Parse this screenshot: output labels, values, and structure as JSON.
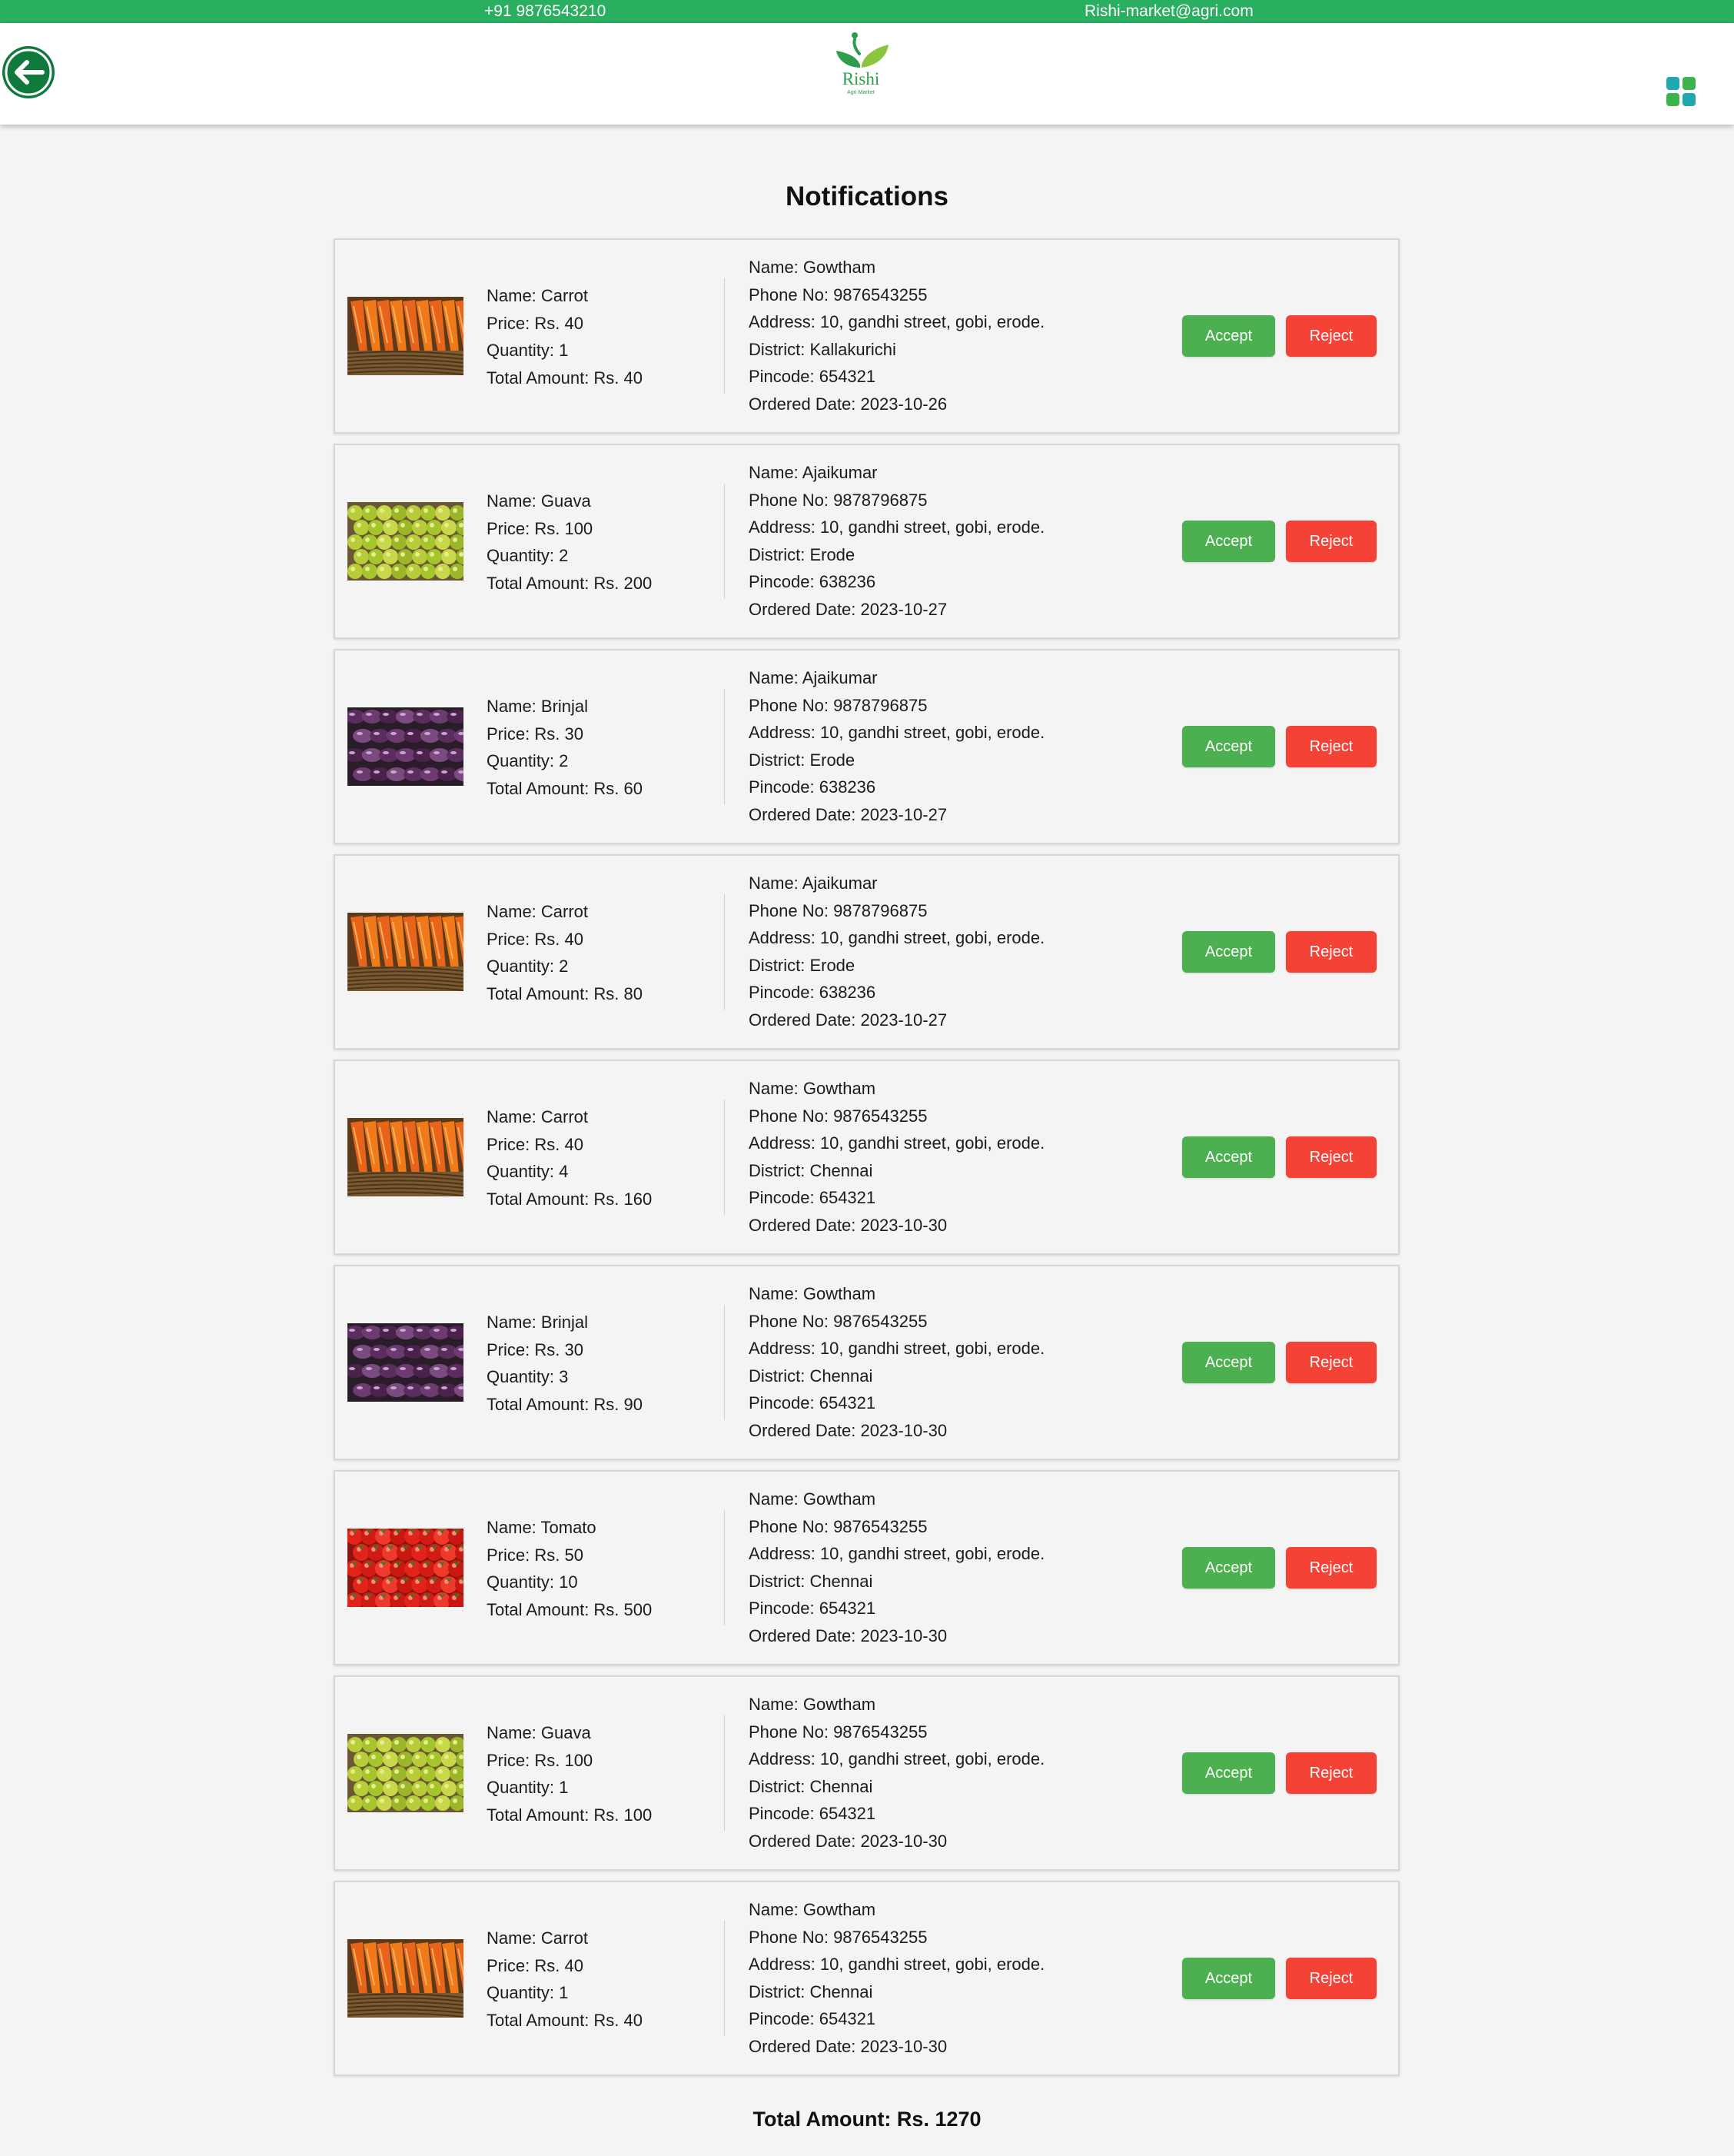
{
  "topbar": {
    "phone": "+91 9876543210",
    "email": "Rishi-market@agri.com"
  },
  "header": {
    "back_icon": "arrow-left-circle-icon",
    "logo_name": "Rishi",
    "logo_sub": "Agri Market",
    "menu_icon": "grid-menu-icon"
  },
  "page": {
    "title": "Notifications",
    "total_amount": "Total Amount: Rs. 1270"
  },
  "colors": {
    "topbar": "#2aae5f",
    "accept": "#4caf50",
    "reject": "#f44336",
    "back_icon": "#0f7a3c",
    "menu_icon": "#20a8b0"
  },
  "orders": [
    {
      "image": "carrot",
      "product_name": "Name: Carrot",
      "price": "Price: Rs. 40",
      "quantity": "Quantity: 1",
      "total": "Total Amount: Rs. 40",
      "customer_name": "Name: Gowtham",
      "phone": "Phone No: 9876543255",
      "address": "Address: 10, gandhi street, gobi, erode.",
      "district": "District: Kallakurichi",
      "pincode": "Pincode: 654321",
      "ordered_date": "Ordered Date: 2023-10-26",
      "accept_label": "Accept",
      "reject_label": "Reject"
    },
    {
      "image": "guava",
      "product_name": "Name: Guava",
      "price": "Price: Rs. 100",
      "quantity": "Quantity: 2",
      "total": "Total Amount: Rs. 200",
      "customer_name": "Name: Ajaikumar",
      "phone": "Phone No: 9878796875",
      "address": "Address: 10, gandhi street, gobi, erode.",
      "district": "District: Erode",
      "pincode": "Pincode: 638236",
      "ordered_date": "Ordered Date: 2023-10-27",
      "accept_label": "Accept",
      "reject_label": "Reject"
    },
    {
      "image": "brinjal",
      "product_name": "Name: Brinjal",
      "price": "Price: Rs. 30",
      "quantity": "Quantity: 2",
      "total": "Total Amount: Rs. 60",
      "customer_name": "Name: Ajaikumar",
      "phone": "Phone No: 9878796875",
      "address": "Address: 10, gandhi street, gobi, erode.",
      "district": "District: Erode",
      "pincode": "Pincode: 638236",
      "ordered_date": "Ordered Date: 2023-10-27",
      "accept_label": "Accept",
      "reject_label": "Reject"
    },
    {
      "image": "carrot",
      "product_name": "Name: Carrot",
      "price": "Price: Rs. 40",
      "quantity": "Quantity: 2",
      "total": "Total Amount: Rs. 80",
      "customer_name": "Name: Ajaikumar",
      "phone": "Phone No: 9878796875",
      "address": "Address: 10, gandhi street, gobi, erode.",
      "district": "District: Erode",
      "pincode": "Pincode: 638236",
      "ordered_date": "Ordered Date: 2023-10-27",
      "accept_label": "Accept",
      "reject_label": "Reject"
    },
    {
      "image": "carrot",
      "product_name": "Name: Carrot",
      "price": "Price: Rs. 40",
      "quantity": "Quantity: 4",
      "total": "Total Amount: Rs. 160",
      "customer_name": "Name: Gowtham",
      "phone": "Phone No: 9876543255",
      "address": "Address: 10, gandhi street, gobi, erode.",
      "district": "District: Chennai",
      "pincode": "Pincode: 654321",
      "ordered_date": "Ordered Date: 2023-10-30",
      "accept_label": "Accept",
      "reject_label": "Reject"
    },
    {
      "image": "brinjal",
      "product_name": "Name: Brinjal",
      "price": "Price: Rs. 30",
      "quantity": "Quantity: 3",
      "total": "Total Amount: Rs. 90",
      "customer_name": "Name: Gowtham",
      "phone": "Phone No: 9876543255",
      "address": "Address: 10, gandhi street, gobi, erode.",
      "district": "District: Chennai",
      "pincode": "Pincode: 654321",
      "ordered_date": "Ordered Date: 2023-10-30",
      "accept_label": "Accept",
      "reject_label": "Reject"
    },
    {
      "image": "tomato",
      "product_name": "Name: Tomato",
      "price": "Price: Rs. 50",
      "quantity": "Quantity: 10",
      "total": "Total Amount: Rs. 500",
      "customer_name": "Name: Gowtham",
      "phone": "Phone No: 9876543255",
      "address": "Address: 10, gandhi street, gobi, erode.",
      "district": "District: Chennai",
      "pincode": "Pincode: 654321",
      "ordered_date": "Ordered Date: 2023-10-30",
      "accept_label": "Accept",
      "reject_label": "Reject"
    },
    {
      "image": "guava",
      "product_name": "Name: Guava",
      "price": "Price: Rs. 100",
      "quantity": "Quantity: 1",
      "total": "Total Amount: Rs. 100",
      "customer_name": "Name: Gowtham",
      "phone": "Phone No: 9876543255",
      "address": "Address: 10, gandhi street, gobi, erode.",
      "district": "District: Chennai",
      "pincode": "Pincode: 654321",
      "ordered_date": "Ordered Date: 2023-10-30",
      "accept_label": "Accept",
      "reject_label": "Reject"
    },
    {
      "image": "carrot",
      "product_name": "Name: Carrot",
      "price": "Price: Rs. 40",
      "quantity": "Quantity: 1",
      "total": "Total Amount: Rs. 40",
      "customer_name": "Name: Gowtham",
      "phone": "Phone No: 9876543255",
      "address": "Address: 10, gandhi street, gobi, erode.",
      "district": "District: Chennai",
      "pincode": "Pincode: 654321",
      "ordered_date": "Ordered Date: 2023-10-30",
      "accept_label": "Accept",
      "reject_label": "Reject"
    }
  ]
}
